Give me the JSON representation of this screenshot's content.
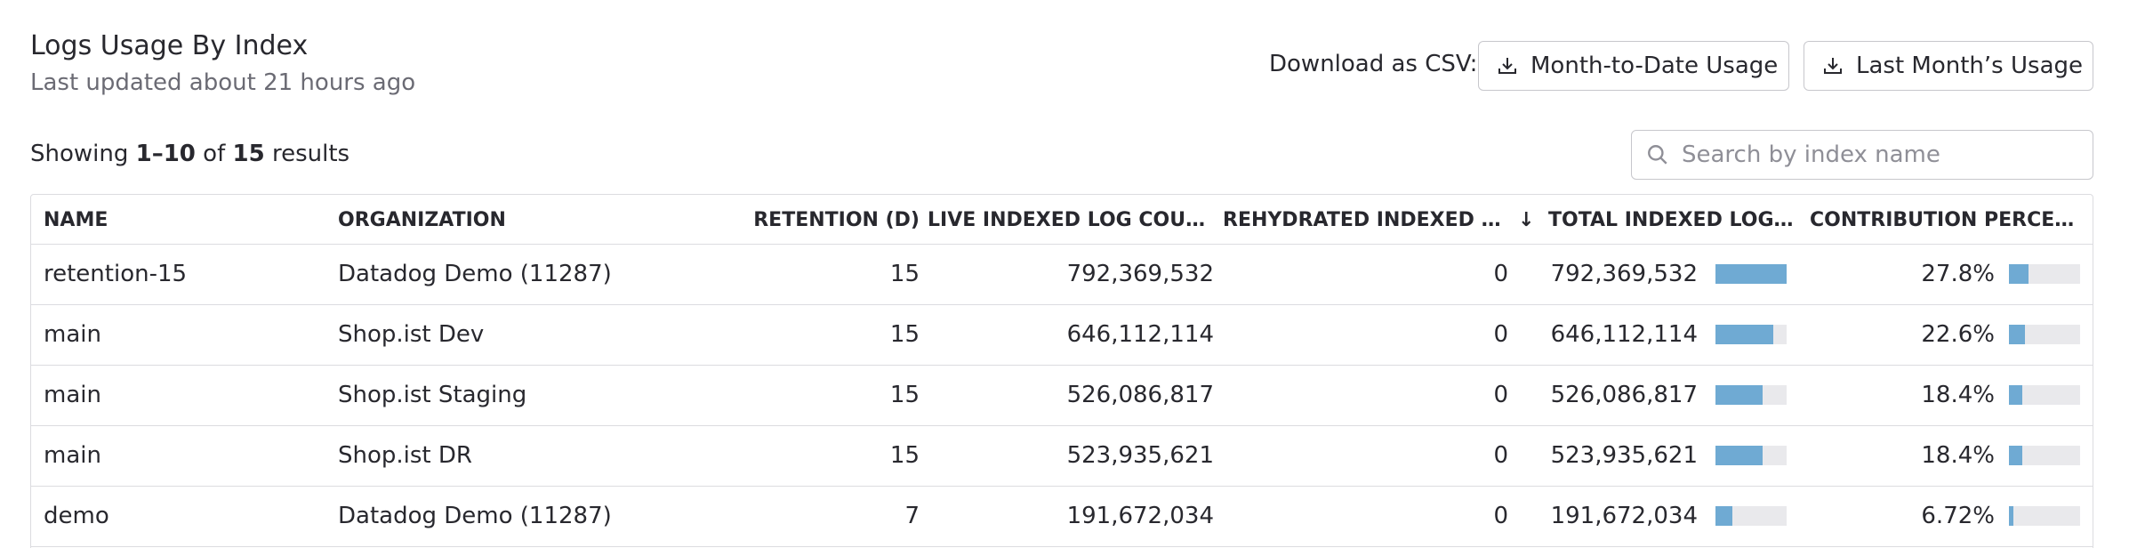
{
  "header": {
    "title": "Logs Usage By Index",
    "subtitle": "Last updated about 21 hours ago",
    "csv_label": "Download as CSV:",
    "mtd_button": "Month-to-Date Usage",
    "last_month_button": "Last Month’s Usage"
  },
  "summary": {
    "prefix": "Showing ",
    "range": "1–10",
    "middle": " of ",
    "total": "15",
    "suffix": " results"
  },
  "search": {
    "placeholder": "Search by index name"
  },
  "table": {
    "columns": {
      "name": "NAME",
      "organization": "ORGANIZATION",
      "retention": "RETENTION (D)",
      "live": "LIVE INDEXED LOG COU…",
      "rehydrated": "REHYDRATED INDEXED …",
      "sort_arrow": "↓",
      "total": "TOTAL INDEXED LOG…",
      "contribution": "CONTRIBUTION PERCE…"
    },
    "rows": [
      {
        "name": "retention-15",
        "organization": "Datadog Demo (11287)",
        "retention": "15",
        "live": "792,369,532",
        "rehydrated": "0",
        "total": "792,369,532",
        "total_fraction": 1.0,
        "contribution": "27.8%",
        "contribution_fraction": 0.278
      },
      {
        "name": "main",
        "organization": "Shop.ist Dev",
        "retention": "15",
        "live": "646,112,114",
        "rehydrated": "0",
        "total": "646,112,114",
        "total_fraction": 0.815,
        "contribution": "22.6%",
        "contribution_fraction": 0.226
      },
      {
        "name": "main",
        "organization": "Shop.ist Staging",
        "retention": "15",
        "live": "526,086,817",
        "rehydrated": "0",
        "total": "526,086,817",
        "total_fraction": 0.664,
        "contribution": "18.4%",
        "contribution_fraction": 0.184
      },
      {
        "name": "main",
        "organization": "Shop.ist DR",
        "retention": "15",
        "live": "523,935,621",
        "rehydrated": "0",
        "total": "523,935,621",
        "total_fraction": 0.661,
        "contribution": "18.4%",
        "contribution_fraction": 0.184
      },
      {
        "name": "demo",
        "organization": "Datadog Demo (11287)",
        "retention": "7",
        "live": "191,672,034",
        "rehydrated": "0",
        "total": "191,672,034",
        "total_fraction": 0.242,
        "contribution": "6.72%",
        "contribution_fraction": 0.0672
      }
    ]
  },
  "colors": {
    "bar_fill": "#6faad3",
    "bar_track": "#e9e9ec"
  }
}
